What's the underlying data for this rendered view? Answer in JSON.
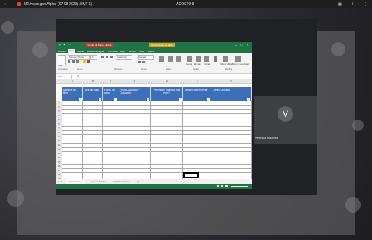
{
  "browser": {
    "tab_title": "M2.Hojas gpo.Alpha- (07-08-2023) (SMT 1)",
    "center_text": "AGOSTO 8",
    "right_icons": [
      "grid-icon",
      "share-icon",
      "more-icon"
    ]
  },
  "excel": {
    "document_tab": "Formato de Bienes - Excel",
    "context_tab": "Herramientas de tabla",
    "menu_tabs": [
      "Archivo",
      "Inicio",
      "Insertar",
      "Diseño de página",
      "Fórmulas",
      "Datos",
      "Revisar",
      "Vista",
      "Diseño"
    ],
    "active_menu": "Inicio",
    "ribbon": {
      "paste": "Pegar",
      "font_name": "Times New Roman",
      "font_size": "11",
      "wrap": "Ajustar texto",
      "number_format": "General",
      "insert": "Insertar",
      "delete": "Eliminar",
      "format": "Formato",
      "sort": "Ordenar y filtrar",
      "find": "Buscar y seleccionar",
      "groups": [
        "Portapapeles",
        "Fuente",
        "Alineación",
        "Número",
        "Estilos",
        "Celdas",
        "Modificar"
      ]
    },
    "name_box": "F21",
    "fx_label": "fx",
    "columns": [
      "A",
      "B",
      "C",
      "D",
      "E",
      "F",
      "G"
    ],
    "headers": [
      "Nombre del Bien",
      "Mes del pago",
      "Forma de pago",
      "Fecha Aprobado y Cotización",
      "Proveedor potencial o al mes?",
      "Tamaño de Empresa",
      "Centro Ubicado"
    ],
    "row_numbers": [
      "1",
      "2",
      "3",
      "4",
      "5",
      "6",
      "7",
      "8",
      "9",
      "10",
      "11",
      "12",
      "13",
      "14",
      "15",
      "16",
      "17",
      "18",
      "19",
      "20"
    ],
    "sheet_tabs": [
      "Hoja de bienes",
      "Hoja de destino",
      "Hoja de resumen"
    ],
    "active_sheet": "Hoja de bienes"
  },
  "participant": {
    "initial": "V",
    "name": "Veronica Figueroa"
  },
  "colors": {
    "excel_green": "#217346",
    "table_header": "#3c6fb8",
    "meet_bg": "#202124",
    "tile_bg": "#3c4043"
  }
}
